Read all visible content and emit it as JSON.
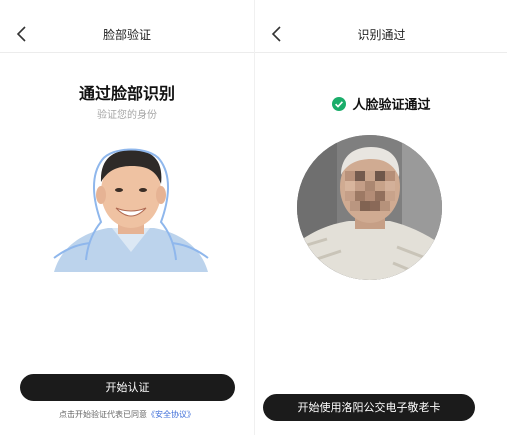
{
  "left_screen": {
    "title": "脸部验证",
    "heading": "通过脸部识别",
    "subheading": "验证您的身份",
    "start_button": "开始认证",
    "agreement_prefix": "点击开始验证代表已同意",
    "agreement_link": "《安全协议》"
  },
  "right_screen": {
    "title": "识别通过",
    "success_message": "人脸验证通过",
    "use_button": "开始使用洛阳公交电子敬老卡"
  },
  "colors": {
    "primary_button": "#1b1b1b",
    "success_green": "#1aad6a",
    "link_blue": "#3d6dd8",
    "frame_blue": "#8fb7ec"
  },
  "icons": {
    "back": "chevron-left-icon",
    "success": "check-circle-icon"
  }
}
